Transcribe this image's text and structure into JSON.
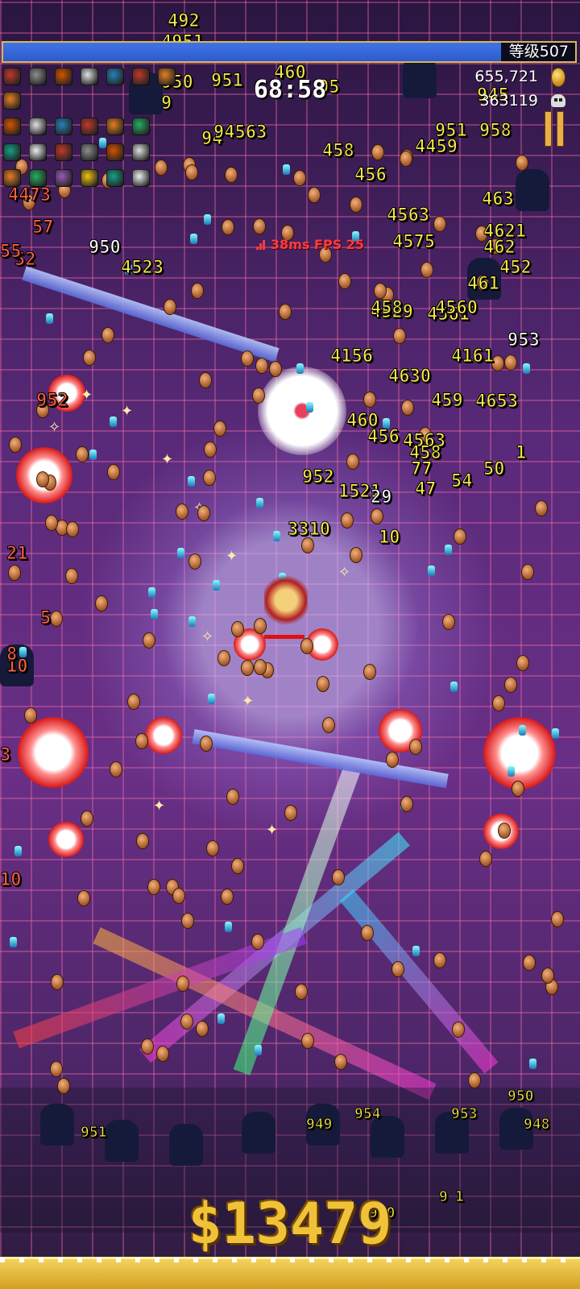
{
  "hud": {
    "level_label": "等级507",
    "timer": "68:58",
    "gold": "655,721",
    "kills": "363119",
    "xp_progress": 0.87,
    "perf": "38ms   FPS 25"
  },
  "equipment": {
    "weapons_row1": [
      "whip-icon",
      "knife-icon",
      "axe-icon",
      "clock-lancet-icon",
      "target-icon",
      "song-icon",
      "bible-icon"
    ],
    "weapons_row2": [
      "bloody-tear-icon"
    ],
    "passives_row1": [
      "hollow-heart-icon",
      "wings-icon",
      "candelabrador-icon",
      "heart-icon",
      "orb-icon",
      "tiramisu-icon"
    ],
    "passives_row2": [
      "crown-icon",
      "ring-icon",
      "skull-icon",
      "clover-icon",
      "attractorb-icon",
      "crown-gold-icon"
    ],
    "passives_row3": [
      "spinach-icon",
      "sword-icon",
      "stone-icon",
      "trident-icon",
      "ring-purple-icon",
      "ring-green-icon"
    ]
  },
  "damage_numbers": {
    "top": [
      "492",
      "4951",
      "951",
      "460",
      "95",
      "950",
      "951",
      "945",
      "94",
      "94563",
      "458",
      "4459",
      "456",
      "4563",
      "4575",
      "462",
      "461",
      "463",
      "9",
      "958",
      "4621",
      "4561"
    ],
    "mid": [
      "950",
      "4523",
      "452",
      "4529",
      "458",
      "4560",
      "4161",
      "4630",
      "4156",
      "953",
      "459",
      "4653",
      "460",
      "456",
      "4563",
      "458",
      "952",
      "1521",
      "29",
      "47",
      "54",
      "3310",
      "10",
      "50",
      "1",
      "77"
    ],
    "left": [
      "52",
      "4473",
      "57",
      "55",
      "952",
      "21",
      "5",
      "10",
      "8",
      "3",
      "10"
    ],
    "bottom": [
      "950",
      "954",
      "949",
      "951",
      "953",
      "948",
      "9",
      "1",
      "950"
    ]
  },
  "money": "$13479",
  "colors": {
    "xp_fill": "#3f74e6",
    "xp_border": "#d8b65a",
    "gold": "#f0c23a",
    "damage": "#f5e94a",
    "perf": "#ff3b3b"
  }
}
